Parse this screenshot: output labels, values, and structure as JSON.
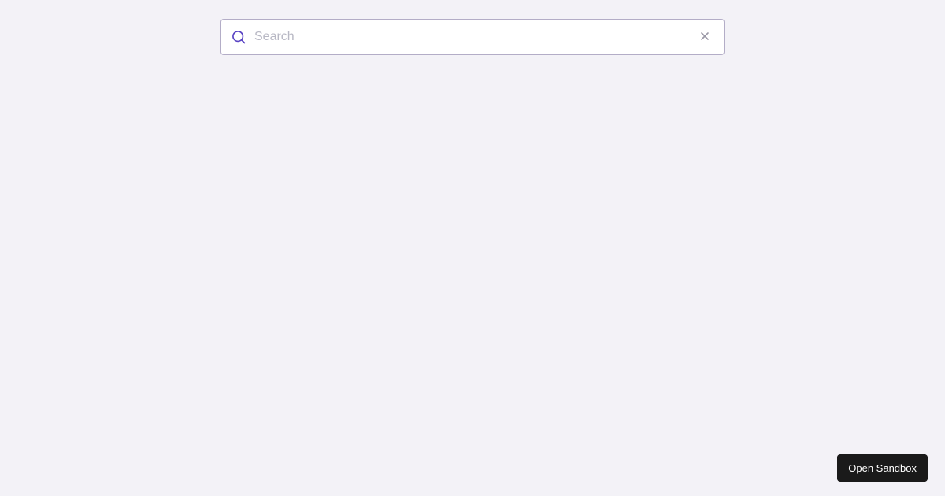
{
  "search": {
    "placeholder": "Search",
    "value": ""
  },
  "footer": {
    "open_sandbox_label": "Open Sandbox"
  }
}
